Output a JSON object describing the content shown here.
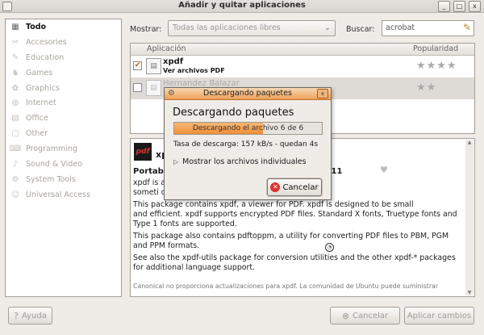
{
  "window": {
    "title": "Añadir y quitar aplicaciones",
    "controls": [
      "_",
      "□",
      "x"
    ]
  },
  "sidebar": {
    "items": [
      {
        "label": "Todo",
        "icon": "all-icon",
        "active": true
      },
      {
        "label": "Accesories",
        "icon": "accessories-icon"
      },
      {
        "label": "Education",
        "icon": "education-icon"
      },
      {
        "label": "Games",
        "icon": "games-icon"
      },
      {
        "label": "Graphics",
        "icon": "graphics-icon"
      },
      {
        "label": "Internet",
        "icon": "internet-icon"
      },
      {
        "label": "Office",
        "icon": "office-icon"
      },
      {
        "label": "Other",
        "icon": "other-icon"
      },
      {
        "label": "Programming",
        "icon": "programming-icon"
      },
      {
        "label": "Sound & Video",
        "icon": "sound-video-icon"
      },
      {
        "label": "System Tools",
        "icon": "system-tools-icon"
      },
      {
        "label": "Universal Access",
        "icon": "universal-access-icon"
      }
    ]
  },
  "filter": {
    "show_label": "Mostrar:",
    "show_value": "Todas las aplicaciones libres",
    "search_label": "Buscar:",
    "search_value": "acrobat"
  },
  "table": {
    "columns": [
      "Aplicación",
      "Popularidad"
    ],
    "rows": [
      {
        "name": "xpdf",
        "desc": "Ver archivos PDF",
        "checked": true,
        "stars": "★★★★"
      },
      {
        "name": "Hernandez Balazar",
        "desc": "",
        "checked": false,
        "stars": "★★"
      }
    ]
  },
  "detail": {
    "icon_label": "pdf",
    "name": "xp",
    "title_left": "Portabl",
    "title_right": "er for X11",
    "lines": [
      "xpdf is a                                     (PDF) files. (These are",
      "someti                                          obe's PDF software.)",
      "This package contains xpdf, a viewer for PDF. xpdf is designed to be small",
      "and efficient. xpdf supports encrypted PDF files. Standard X fonts, Truetype fonts and",
      "Type 1 fonts are supported.",
      "This package also contains pdftoppm, a utility for converting PDF files to PBM, PGM",
      "and PPM formats.",
      "See also the xpdf-utils package for conversion utilities and the other xpdf-* packages",
      "for additional language support."
    ],
    "note": "Canonical no proporciona actualizaciones para xpdf. La comunidad de Ubuntu puede suministrar"
  },
  "buttons": {
    "help": "Ayuda",
    "cancel": "Cancelar",
    "apply": "Aplicar cambios"
  },
  "dialog": {
    "title": "Descargando paquetes",
    "heading": "Descargando paquetes",
    "progress_text": "Descargando el archivo 6 de 6",
    "progress_fraction": 0.6,
    "rate": "Tasa de descarga: 157 kB/s - quedan 4s",
    "expander": "Mostrar los archivos individuales",
    "cancel": "Cancelar"
  }
}
